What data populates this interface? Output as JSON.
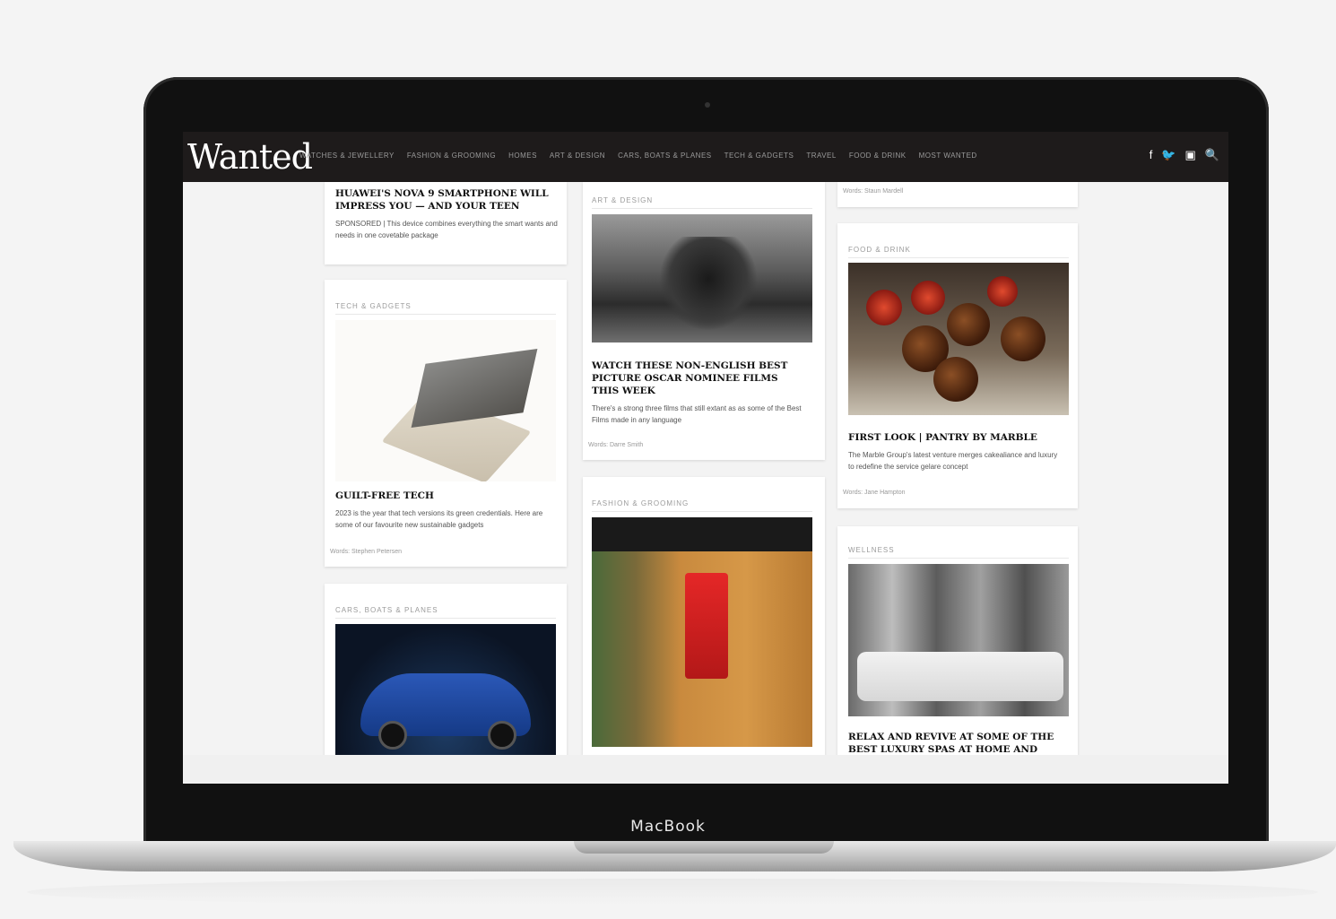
{
  "device": {
    "label": "MacBook"
  },
  "site": {
    "logo": "Wanted",
    "nav": [
      "WATCHES & JEWELLERY",
      "FASHION & GROOMING",
      "HOMES",
      "ART & DESIGN",
      "CARS, BOATS & PLANES",
      "TECH & GADGETS",
      "TRAVEL",
      "FOOD & DRINK",
      "MOST WANTED"
    ],
    "icons": [
      "facebook-icon",
      "twitter-icon",
      "instagram-icon",
      "search-icon"
    ]
  },
  "cards": {
    "phone": {
      "title": "HUAWEI'S NOVA 9 SmARTPHONE WILL IMPRESS YOU — AND YOUR TEEN",
      "excerpt": "SPONSORED | This device combines everything the smart wants and needs in one covetable package"
    },
    "tech": {
      "category": "TECH & GADGETS",
      "title": "GUILT-FREE TECH",
      "excerpt": "2023 is the year that tech versions its green credentials. Here are some of our favourite new sustainable gadgets",
      "meta": "Words: Stephen Petersen"
    },
    "cars": {
      "category": "CARS, BOATS & PLANES"
    },
    "art_top": {
      "category": "ART & DESIGN"
    },
    "films": {
      "title": "WATCH THESE NON-ENGLISH BEST PICTURE OSCAR NOMINEE FILMS THIS WEEK",
      "excerpt": "There's a strong three films that still extant as as some of the Best Films made in any language",
      "meta": "Words: Darre Smith"
    },
    "fashion": {
      "category": "FASHION & GROOMING"
    },
    "top_right": {
      "meta": "Words: Staun Mardell"
    },
    "food": {
      "category": "FOOD & DRINK",
      "title": "FIRST LOOK | PANTRY BY MARBLE",
      "excerpt": "The Marble Group's latest venture merges cakealiance and luxury to redefine the service gelare concept",
      "meta": "Words: Jane Hampton"
    },
    "wellness": {
      "category": "WELLNESS",
      "title": "RELAX AND REVIVE AT SOME OF THE BEST LUXURY SPAS AT HOME AND ABROAD"
    }
  }
}
